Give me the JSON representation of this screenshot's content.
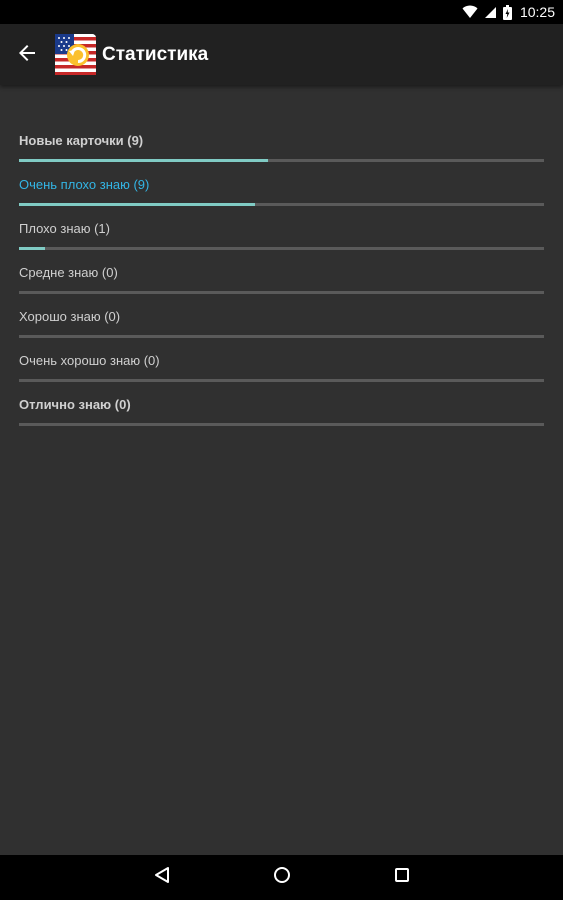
{
  "status_bar": {
    "time": "10:25",
    "icons": [
      "wifi-icon",
      "cell-signal-icon",
      "battery-icon"
    ]
  },
  "app_bar": {
    "title": "Статистика",
    "back_icon": "arrow-back-icon",
    "logo": "app-logo-flag"
  },
  "stats": [
    {
      "label": "Новые карточки (9)",
      "count": 9,
      "progress_percent": 47.5,
      "bold": true,
      "active": false
    },
    {
      "label": "Очень плохо знаю (9)",
      "count": 9,
      "progress_percent": 45,
      "bold": false,
      "active": true
    },
    {
      "label": "Плохо знаю (1)",
      "count": 1,
      "progress_percent": 5,
      "bold": false,
      "active": false
    },
    {
      "label": "Средне знаю (0)",
      "count": 0,
      "progress_percent": 0,
      "bold": false,
      "active": false
    },
    {
      "label": "Хорошо знаю (0)",
      "count": 0,
      "progress_percent": 0,
      "bold": false,
      "active": false
    },
    {
      "label": "Очень хорошо знаю (0)",
      "count": 0,
      "progress_percent": 0,
      "bold": false,
      "active": false
    },
    {
      "label": "Отлично знаю (0)",
      "count": 0,
      "progress_percent": 0,
      "bold": true,
      "active": false
    }
  ],
  "nav_bar": {
    "icons": [
      "nav-back-icon",
      "nav-home-icon",
      "nav-recents-icon"
    ]
  },
  "colors": {
    "background": "#303030",
    "app_bar": "#212121",
    "progress_fill": "#80cbc4",
    "progress_track": "#5a5a5a",
    "active_label": "#33b5e5",
    "label": "#d0d0d0"
  }
}
